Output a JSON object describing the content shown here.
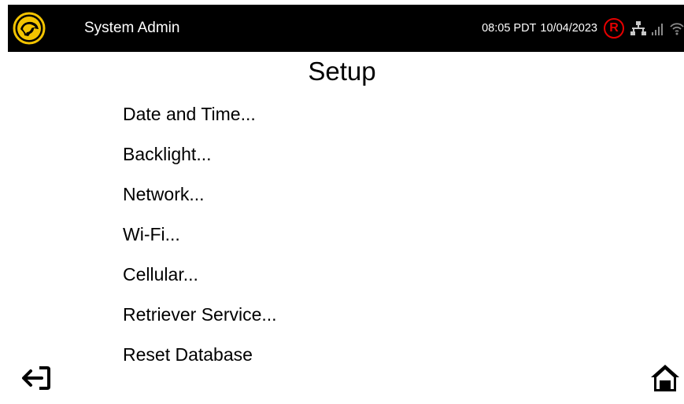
{
  "status_bar": {
    "user": "System Admin",
    "time": "08:05 PDT",
    "date": "10/04/2023",
    "retriever_badge": "R",
    "icons": [
      "network-icon",
      "cellular-signal-icon",
      "wifi-icon"
    ],
    "colors": {
      "background": "#000000",
      "logo": "#f2c300",
      "badge": "#e60000"
    }
  },
  "page": {
    "title": "Setup"
  },
  "menu": {
    "items": [
      {
        "label": "Date and Time..."
      },
      {
        "label": "Backlight..."
      },
      {
        "label": "Network..."
      },
      {
        "label": "Wi-Fi..."
      },
      {
        "label": "Cellular..."
      },
      {
        "label": "Retriever Service..."
      },
      {
        "label": "Reset Database"
      }
    ]
  },
  "footer": {
    "left_icon": "logout-icon",
    "right_icon": "home-icon"
  }
}
